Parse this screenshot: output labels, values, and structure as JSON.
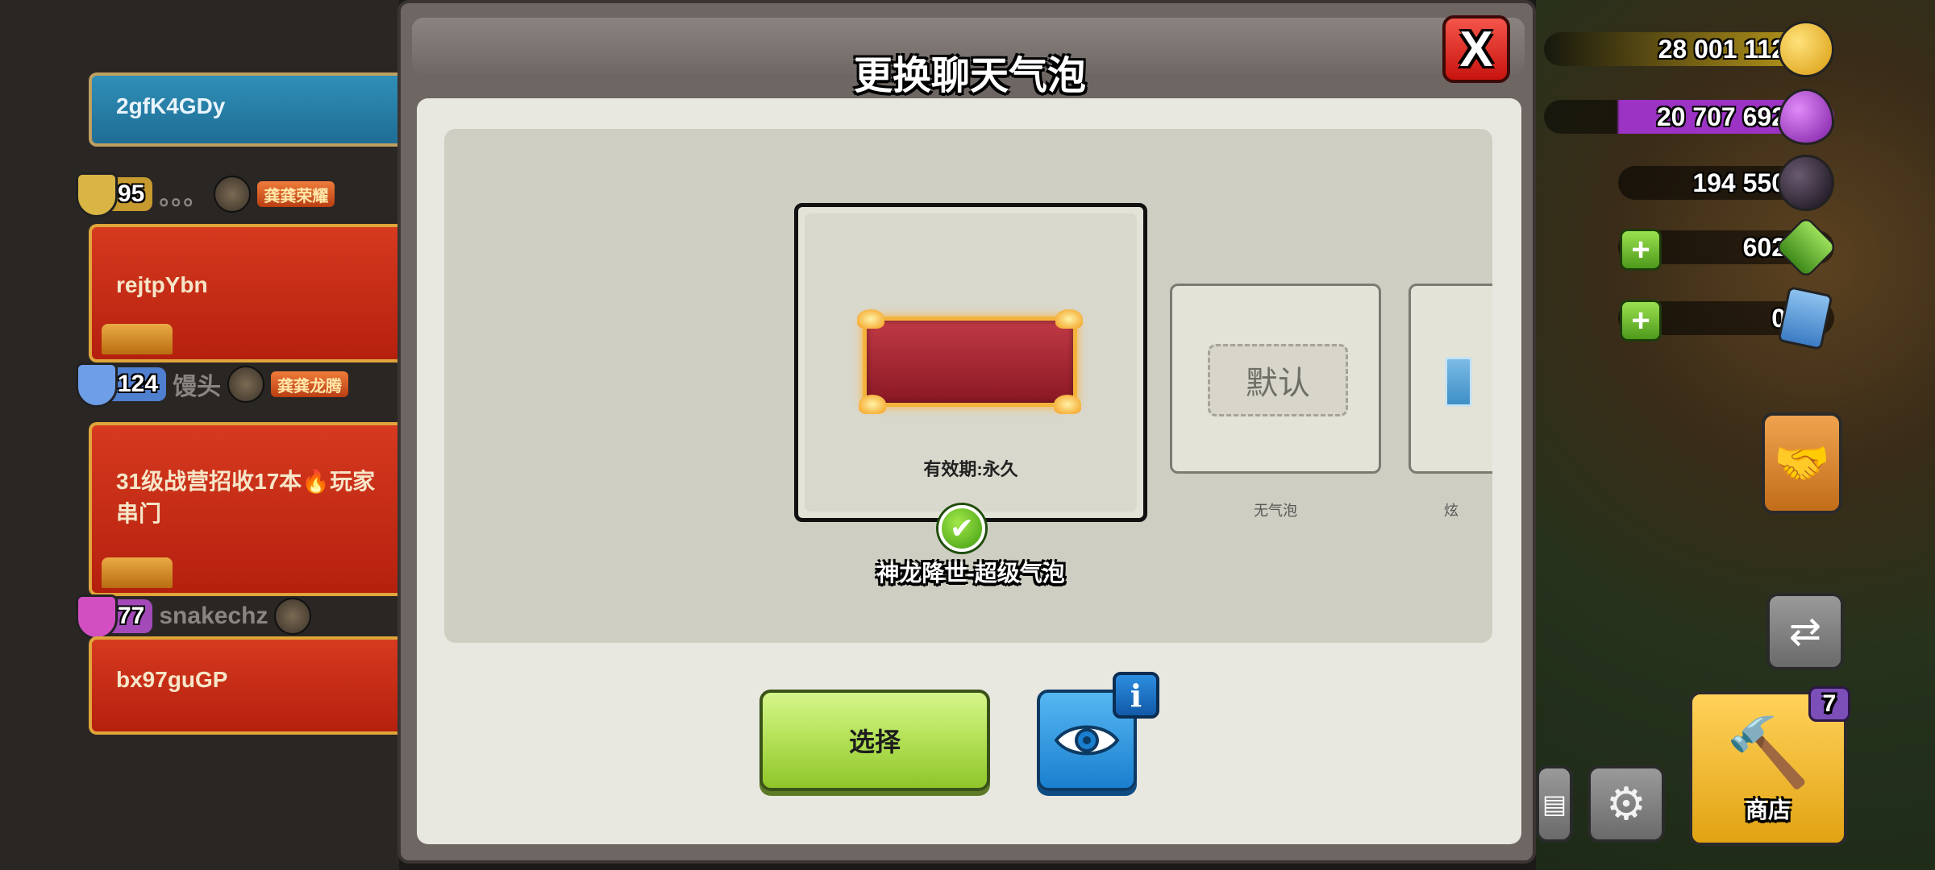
{
  "dialog": {
    "title": "更换聊天气泡",
    "close_label": "X",
    "selected_bubble": {
      "validity": "有效期:永久",
      "name": "神龙降世-超级气泡"
    },
    "default_bubble": {
      "button_label": "默认",
      "name": "无气泡"
    },
    "next_bubble_name": "炫",
    "select_button": "选择",
    "info_label": "i"
  },
  "chat": {
    "messages": [
      {
        "text": "2gfK4GDy",
        "style": "blue"
      },
      {
        "text": "rejtpYbn",
        "style": "red"
      },
      {
        "text": "31级战营招收17本🔥玩家串门",
        "style": "red"
      },
      {
        "text": "bx97guGP",
        "style": "red"
      }
    ],
    "senders": [
      {
        "trophies": "95",
        "name": "。。。",
        "clan_tag": "龚龚荣耀"
      },
      {
        "trophies": "124",
        "name": "馒头",
        "clan_tag": "龚龚龙腾"
      },
      {
        "trophies": "77",
        "name": "snakechz",
        "clan_tag": ""
      }
    ],
    "shield_colors": [
      "#d9b544",
      "#6f9ee8",
      "#d14fc1"
    ]
  },
  "hud": {
    "gold": "28 001 112",
    "elixir": "20 707 692",
    "dark_elixir": "194 550",
    "gems": "602",
    "tickets": "0",
    "shop_label": "商店",
    "shop_badge": "7",
    "colors": {
      "gold": "#f3c52b",
      "elixir": "#b23fd6",
      "dark_elixir": "#2a2230",
      "gems": "#5fb930"
    }
  }
}
